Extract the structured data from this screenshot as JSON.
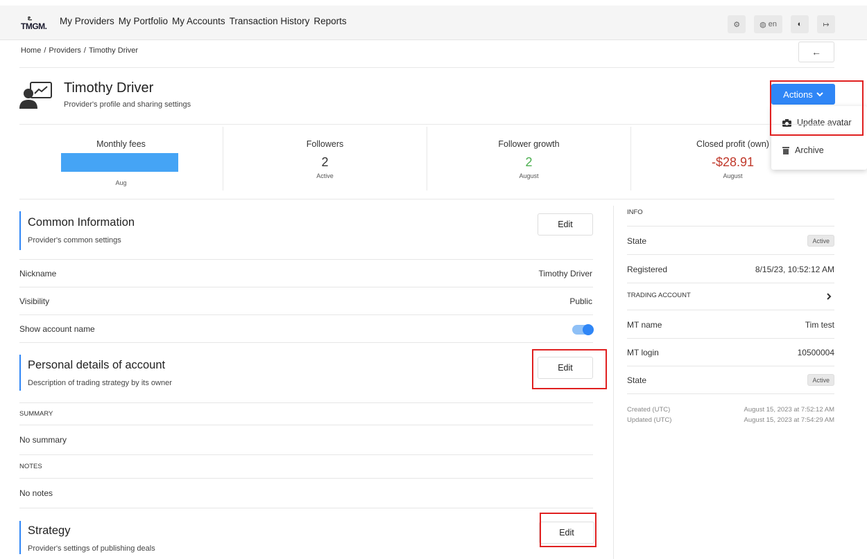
{
  "nav": {
    "logo_mark": "ఽ",
    "logo_text": "TMGM.",
    "items": [
      "My Providers",
      "My Portfolio",
      "My Accounts",
      "Transaction History",
      "Reports"
    ],
    "language": "en"
  },
  "breadcrumb": {
    "items": [
      "Home",
      "/",
      "Providers",
      "/",
      "Timothy Driver"
    ]
  },
  "provider": {
    "name": "Timothy Driver",
    "subtitle": "Provider's profile and sharing settings"
  },
  "actions": {
    "label": "Actions",
    "menu": [
      "Update avatar",
      "Archive"
    ]
  },
  "stats": {
    "monthly_fees": {
      "label": "Monthly fees",
      "sub": "Aug"
    },
    "followers": {
      "label": "Followers",
      "value": "2",
      "sub": "Active"
    },
    "follower_growth": {
      "label": "Follower growth",
      "value": "2",
      "sub": "August"
    },
    "closed_profit": {
      "label": "Closed profit (own)",
      "value": "-$28.91",
      "sub": "August"
    }
  },
  "common": {
    "title": "Common Information",
    "subtitle": "Provider's common settings",
    "edit": "Edit",
    "rows": [
      {
        "label": "Nickname",
        "value": "Timothy Driver"
      },
      {
        "label": "Visibility",
        "value": "Public"
      },
      {
        "label": "Show account name",
        "value": ""
      }
    ]
  },
  "personal": {
    "title": "Personal details of account",
    "subtitle": "Description of trading strategy by its owner",
    "edit": "Edit",
    "summary_label": "SUMMARY",
    "summary": "No summary",
    "notes_label": "NOTES",
    "notes": "No notes"
  },
  "strategy": {
    "title": "Strategy",
    "subtitle": "Provider's settings of publishing deals",
    "edit": "Edit"
  },
  "info": {
    "title": "INFO",
    "state_label": "State",
    "state": "Active",
    "registered_label": "Registered",
    "registered": "8/15/23, 10:52:12 AM",
    "trading_title": "TRADING ACCOUNT",
    "mt_name_label": "MT name",
    "mt_name": "Tim test",
    "mt_login_label": "MT login",
    "mt_login": "10500004",
    "acc_state_label": "State",
    "acc_state": "Active",
    "created_label": "Created (UTC)",
    "created": "August 15, 2023 at 7:52:12 AM",
    "updated_label": "Updated (UTC)",
    "updated": "August 15, 2023 at 7:54:29 AM"
  },
  "colors": {
    "accent": "#2f86f6",
    "positive": "#4caf50",
    "negative": "#c0392b",
    "highlight_box": "#e02020"
  }
}
